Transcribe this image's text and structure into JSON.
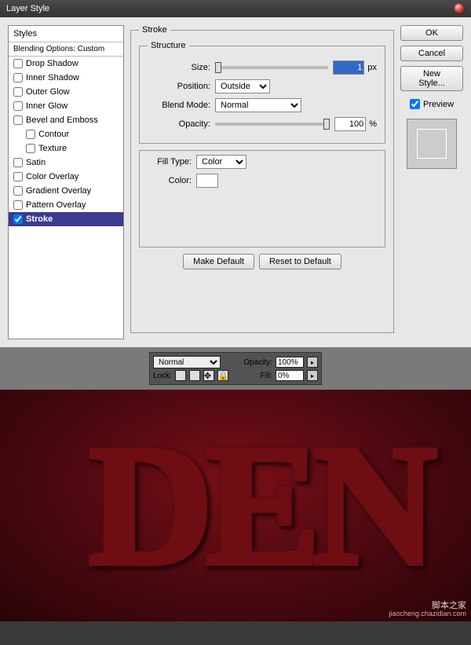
{
  "title": "Layer Style",
  "styles_header": "Styles",
  "blending_header": "Blending Options: Custom",
  "style_items": {
    "drop_shadow": "Drop Shadow",
    "inner_shadow": "Inner Shadow",
    "outer_glow": "Outer Glow",
    "inner_glow": "Inner Glow",
    "bevel": "Bevel and Emboss",
    "contour": "Contour",
    "texture": "Texture",
    "satin": "Satin",
    "color_overlay": "Color Overlay",
    "gradient_overlay": "Gradient Overlay",
    "pattern_overlay": "Pattern Overlay",
    "stroke": "Stroke"
  },
  "stroke": {
    "legend_outer": "Stroke",
    "legend_structure": "Structure",
    "size_label": "Size:",
    "size_value": "1",
    "size_unit": "px",
    "position_label": "Position:",
    "position_value": "Outside",
    "blend_label": "Blend Mode:",
    "blend_value": "Normal",
    "opacity_label": "Opacity:",
    "opacity_value": "100",
    "opacity_unit": "%",
    "filltype_label": "Fill Type:",
    "filltype_value": "Color",
    "color_label": "Color:",
    "color_hex": "#ffffff",
    "make_default": "Make Default",
    "reset_default": "Reset to Default"
  },
  "buttons": {
    "ok": "OK",
    "cancel": "Cancel",
    "new_style": "New Style...",
    "preview": "Preview"
  },
  "layers": {
    "blend_mode": "Normal",
    "opacity_label": "Opacity:",
    "opacity_value": "100%",
    "lock_label": "Lock:",
    "fill_label": "Fill:",
    "fill_value": "0%"
  },
  "watermark": {
    "main": "脚本之家",
    "sub": "jiaocheng.chazidian.com"
  }
}
